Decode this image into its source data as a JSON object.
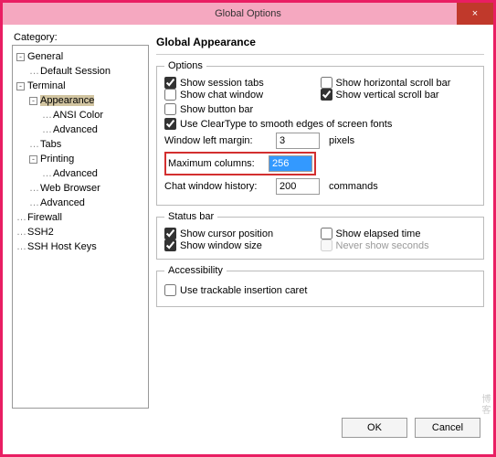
{
  "window": {
    "title": "Global Options",
    "close": "×"
  },
  "category_label": "Category:",
  "tree": {
    "general": "General",
    "default_session": "Default Session",
    "terminal": "Terminal",
    "appearance": "Appearance",
    "ansi_color": "ANSI Color",
    "advanced1": "Advanced",
    "tabs": "Tabs",
    "printing": "Printing",
    "advanced2": "Advanced",
    "web_browser": "Web Browser",
    "advanced3": "Advanced",
    "firewall": "Firewall",
    "ssh2": "SSH2",
    "ssh_host_keys": "SSH Host Keys"
  },
  "panel": {
    "heading": "Global Appearance",
    "options": {
      "legend": "Options",
      "show_session_tabs": "Show session tabs",
      "show_horizontal_scroll": "Show horizontal scroll bar",
      "show_chat_window": "Show chat window",
      "show_vertical_scroll": "Show vertical scroll bar",
      "show_button_bar": "Show button bar",
      "use_cleartype": "Use ClearType to smooth edges of screen fonts",
      "window_left_margin": "Window left margin:",
      "window_left_margin_value": "3",
      "pixels": "pixels",
      "maximum_columns": "Maximum columns:",
      "maximum_columns_value": "256",
      "chat_window_history": "Chat window history:",
      "chat_window_history_value": "200",
      "commands": "commands"
    },
    "status_bar": {
      "legend": "Status bar",
      "show_cursor_position": "Show cursor position",
      "show_elapsed_time": "Show elapsed time",
      "show_window_size": "Show window size",
      "never_show_seconds": "Never show seconds"
    },
    "accessibility": {
      "legend": "Accessibility",
      "use_trackable": "Use trackable insertion caret"
    }
  },
  "buttons": {
    "ok": "OK",
    "cancel": "Cancel"
  },
  "watermark": "博客"
}
